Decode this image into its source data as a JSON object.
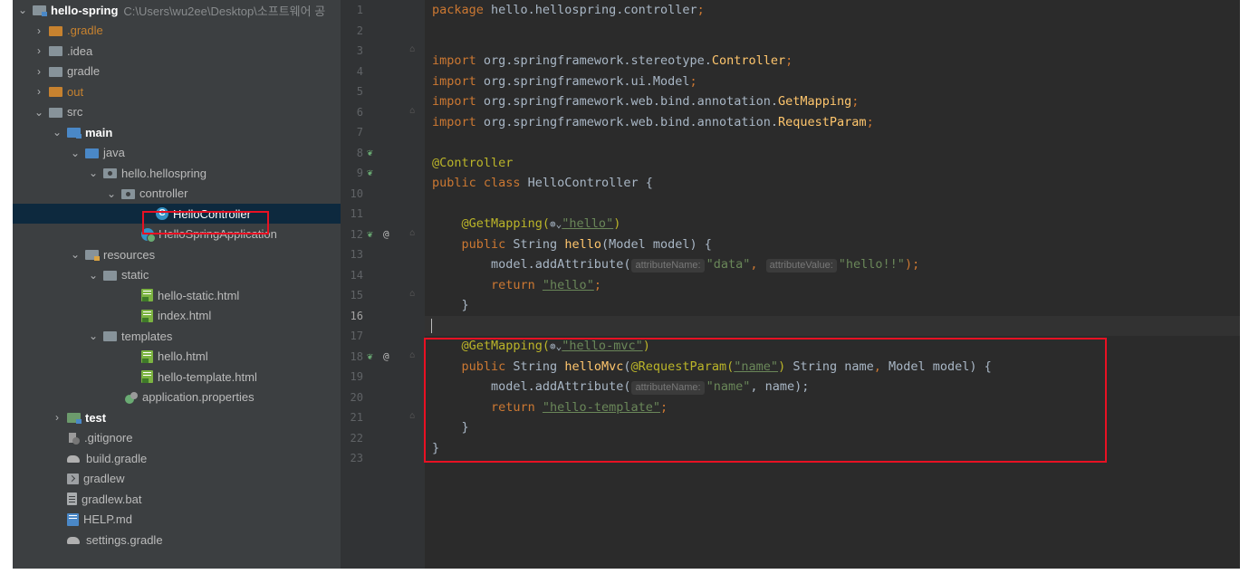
{
  "project": {
    "name": "hello-spring",
    "path": "C:\\Users\\wu2ee\\Desktop\\소프트웨어 공"
  },
  "tree": [
    {
      "label": ".gradle",
      "arrow": "›",
      "icon": "folder-orange-icon"
    },
    {
      "label": ".idea",
      "arrow": "›",
      "icon": "folder-icon"
    },
    {
      "label": "gradle",
      "arrow": "›",
      "icon": "folder-icon"
    },
    {
      "label": "out",
      "arrow": "›",
      "icon": "folder-orange-icon"
    },
    {
      "label": "src",
      "arrow": "⌄",
      "icon": "folder-icon"
    },
    {
      "label": "main",
      "arrow": "⌄",
      "icon": "source-root-folder-icon"
    },
    {
      "label": "java",
      "arrow": "⌄",
      "icon": "java-folder-icon"
    },
    {
      "label": "hello.hellospring",
      "arrow": "⌄",
      "icon": "package-icon"
    },
    {
      "label": "controller",
      "arrow": "⌄",
      "icon": "package-icon"
    },
    {
      "label": "HelloController",
      "arrow": "",
      "icon": "class-icon"
    },
    {
      "label": "HelloSpringApplication",
      "arrow": "",
      "icon": "spring-class-icon"
    },
    {
      "label": "resources",
      "arrow": "⌄",
      "icon": "resources-folder-icon"
    },
    {
      "label": "static",
      "arrow": "⌄",
      "icon": "folder-icon"
    },
    {
      "label": "hello-static.html",
      "arrow": "",
      "icon": "html-file-icon"
    },
    {
      "label": "index.html",
      "arrow": "",
      "icon": "html-file-icon"
    },
    {
      "label": "templates",
      "arrow": "⌄",
      "icon": "folder-icon"
    },
    {
      "label": "hello.html",
      "arrow": "",
      "icon": "html-file-icon"
    },
    {
      "label": "hello-template.html",
      "arrow": "",
      "icon": "html-file-icon"
    },
    {
      "label": "application.properties",
      "arrow": "",
      "icon": "properties-file-icon"
    },
    {
      "label": "test",
      "arrow": "›",
      "icon": "test-folder-icon"
    },
    {
      "label": ".gitignore",
      "arrow": "",
      "icon": "gitignore-file-icon"
    },
    {
      "label": "build.gradle",
      "arrow": "",
      "icon": "gradle-file-icon"
    },
    {
      "label": "gradlew",
      "arrow": "",
      "icon": "terminal-file-icon"
    },
    {
      "label": "gradlew.bat",
      "arrow": "",
      "icon": "text-file-icon"
    },
    {
      "label": "HELP.md",
      "arrow": "",
      "icon": "markdown-file-icon"
    },
    {
      "label": "settings.gradle",
      "arrow": "",
      "icon": "gradle-file-icon"
    }
  ],
  "line_numbers": [
    "1",
    "2",
    "3",
    "4",
    "5",
    "6",
    "7",
    "8",
    "9",
    "10",
    "11",
    "12",
    "13",
    "14",
    "15",
    "16",
    "17",
    "18",
    "19",
    "20",
    "21",
    "22",
    "23"
  ],
  "code": {
    "l1": {
      "a": "package ",
      "b": "hello.hellospring.controller",
      "c": ";"
    },
    "l3": {
      "a": "import ",
      "b": "org.springframework.stereotype.",
      "c": "Controller",
      "d": ";"
    },
    "l4": {
      "a": "import ",
      "b": "org.springframework.ui.Model",
      "c": ";"
    },
    "l5": {
      "a": "import ",
      "b": "org.springframework.web.bind.annotation.",
      "c": "GetMapping",
      "d": ";"
    },
    "l6": {
      "a": "import ",
      "b": "org.springframework.web.bind.annotation.",
      "c": "RequestParam",
      "d": ";"
    },
    "l8": {
      "a": "@Controller"
    },
    "l9": {
      "a": "public class ",
      "b": "HelloController {"
    },
    "l11": {
      "a": "    @GetMapping(",
      "g": "⊚⌄",
      "s": "\"hello\"",
      "c": ")"
    },
    "l12": {
      "a": "    public ",
      "b": "String ",
      "f": "hello",
      "c": "(Model model) {"
    },
    "l13": {
      "a": "        model.addAttribute(",
      "h1": "attributeName:",
      "s1": "\"data\"",
      "c": ", ",
      "h2": "attributeValue:",
      "s2": "\"hello!!\"",
      "d": ");"
    },
    "l14": {
      "a": "        return ",
      "s": "\"hello\"",
      "c": ";"
    },
    "l15": {
      "a": "    }"
    },
    "l17": {
      "a": "    @GetMapping(",
      "g": "⊚⌄",
      "s": "\"hello-mvc\"",
      "c": ")"
    },
    "l18": {
      "a": "    public ",
      "b": "String ",
      "f": "helloMvc",
      "c": "(",
      "ann": "@RequestParam(",
      "s": "\"name\"",
      "ann2": ")",
      "d": " String name",
      "e": ", ",
      "f2": "Model model) {"
    },
    "l19": {
      "a": "        model.addAttribute(",
      "h1": "attributeName:",
      "s1": "\"name\"",
      "c": ", name);"
    },
    "l20": {
      "a": "        return ",
      "s": "\"hello-template\"",
      "c": ";"
    },
    "l21": {
      "a": "    }"
    },
    "l22": {
      "a": "}"
    }
  },
  "gutter_icons": {
    "spring_bean": "spring-bean-icon",
    "mapping": "@",
    "fold": "fold-marker-icon"
  },
  "colors": {
    "highlight_box": "#e81123",
    "selection": "#0d293e",
    "keyword": "#cc7832",
    "string": "#6a8759",
    "annotation": "#bbb529",
    "method": "#ffc66d"
  }
}
